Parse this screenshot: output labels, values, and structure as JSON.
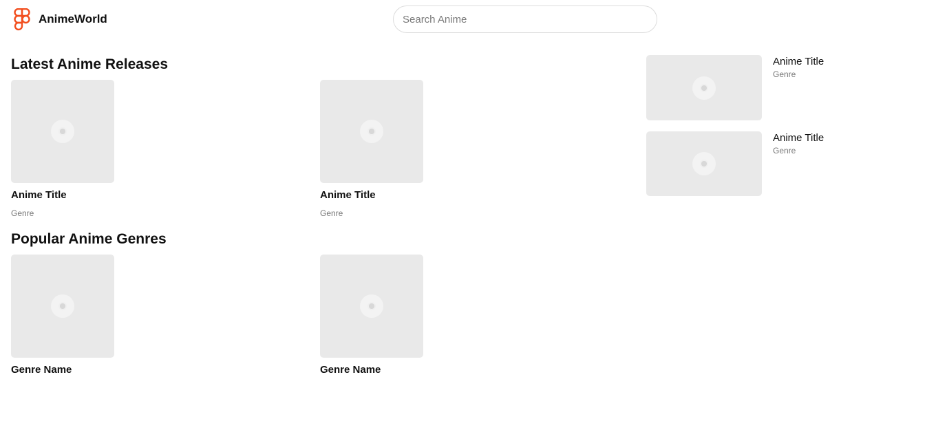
{
  "header": {
    "brand": "AnimeWorld",
    "search_placeholder": "Search Anime"
  },
  "latest": {
    "title": "Latest Anime Releases",
    "cards": [
      {
        "title": "Anime Title",
        "genre": "Genre"
      },
      {
        "title": "Anime Title",
        "genre": "Genre"
      }
    ]
  },
  "genres": {
    "title": "Popular Anime Genres",
    "cards": [
      {
        "name": "Genre Name"
      },
      {
        "name": "Genre Name"
      }
    ]
  },
  "sidebar": {
    "items": [
      {
        "title": "Anime Title",
        "genre": "Genre"
      },
      {
        "title": "Anime Title",
        "genre": "Genre"
      }
    ]
  },
  "colors": {
    "logo_red": "#f24e1e",
    "placeholder_gray": "#e9e9e9"
  }
}
